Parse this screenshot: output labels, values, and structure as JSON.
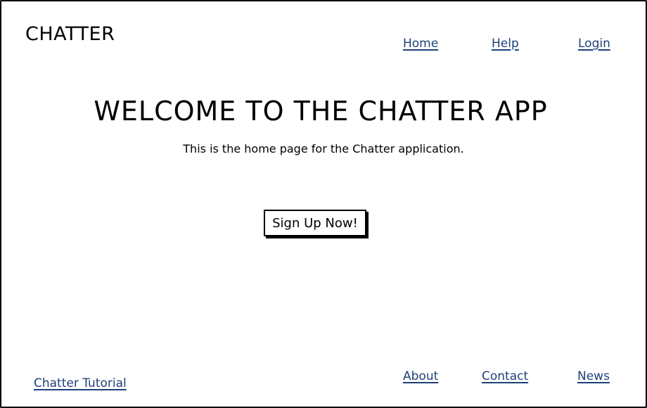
{
  "header": {
    "logo": "CHATTER",
    "nav": {
      "home": "Home",
      "help": "Help",
      "login": "Login"
    }
  },
  "main": {
    "title": "WELCOME TO THE CHATTER APP",
    "subtitle": "This is the home page for the Chatter application.",
    "signup_button": "Sign Up Now!"
  },
  "footer": {
    "tutorial": "Chatter Tutorial",
    "about": "About",
    "contact": "Contact",
    "news": "News"
  },
  "colors": {
    "link": "#1f3f7a",
    "text": "#000000",
    "background": "#ffffff"
  }
}
